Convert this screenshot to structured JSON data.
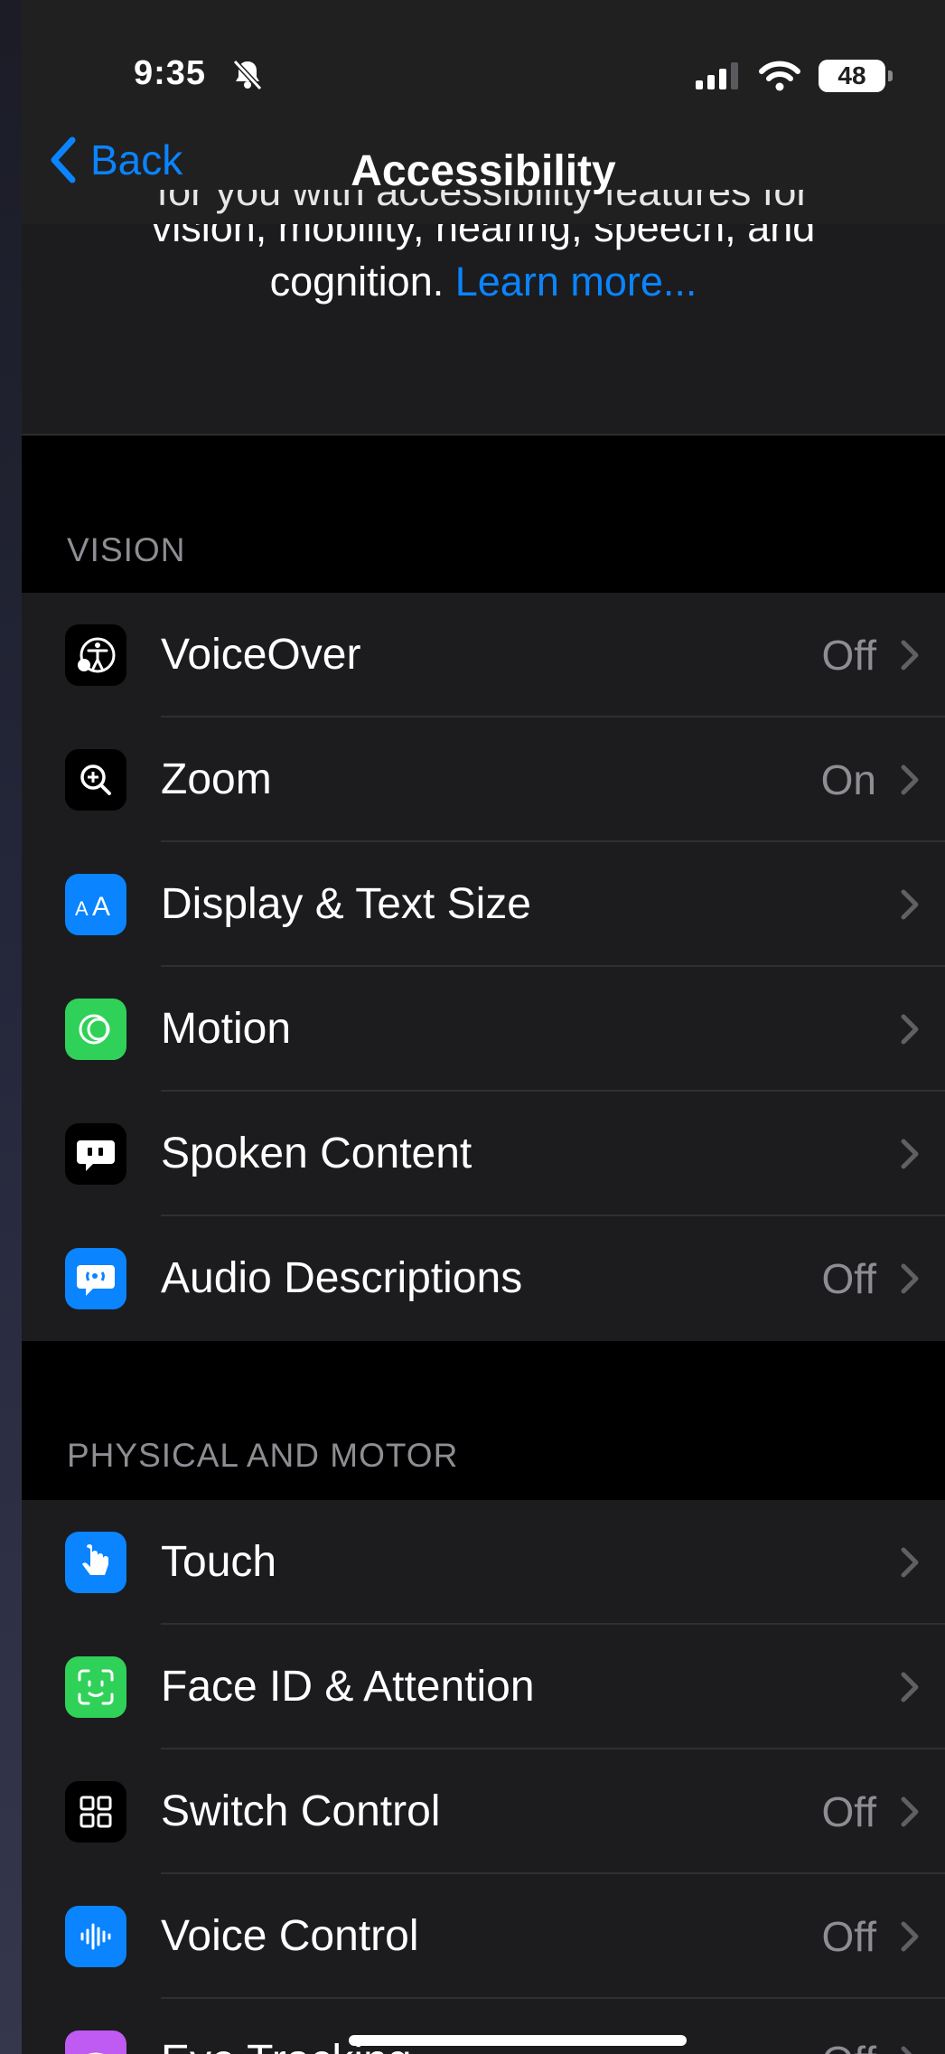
{
  "status_bar": {
    "time": "9:35",
    "battery": "48"
  },
  "nav": {
    "back_label": "Back",
    "title": "Accessibility"
  },
  "intro": {
    "partial_line": "for you with accessibility features for",
    "text": "vision, mobility, hearing, speech, and cognition.",
    "link": "Learn more..."
  },
  "sections": {
    "vision": {
      "header": "VISION",
      "items": [
        {
          "label": "VoiceOver",
          "value": "Off",
          "icon": "voiceover-icon",
          "color": "#000000"
        },
        {
          "label": "Zoom",
          "value": "On",
          "icon": "zoom-icon",
          "color": "#000000"
        },
        {
          "label": "Display & Text Size",
          "value": "",
          "icon": "text-size-icon",
          "color": "#0a84ff"
        },
        {
          "label": "Motion",
          "value": "",
          "icon": "motion-icon",
          "color": "#30d158"
        },
        {
          "label": "Spoken Content",
          "value": "",
          "icon": "spoken-content-icon",
          "color": "#000000"
        },
        {
          "label": "Audio Descriptions",
          "value": "Off",
          "icon": "audio-descriptions-icon",
          "color": "#0a84ff"
        }
      ]
    },
    "physical": {
      "header": "PHYSICAL AND MOTOR",
      "items": [
        {
          "label": "Touch",
          "value": "",
          "icon": "touch-icon",
          "color": "#0a84ff"
        },
        {
          "label": "Face ID & Attention",
          "value": "",
          "icon": "face-id-icon",
          "color": "#30d158"
        },
        {
          "label": "Switch Control",
          "value": "Off",
          "icon": "switch-control-icon",
          "color": "#000000"
        },
        {
          "label": "Voice Control",
          "value": "Off",
          "icon": "voice-control-icon",
          "color": "#0a84ff"
        },
        {
          "label": "Eye Tracking",
          "value": "Off",
          "icon": "eye-tracking-icon",
          "color": "#bf5af2"
        }
      ]
    }
  }
}
